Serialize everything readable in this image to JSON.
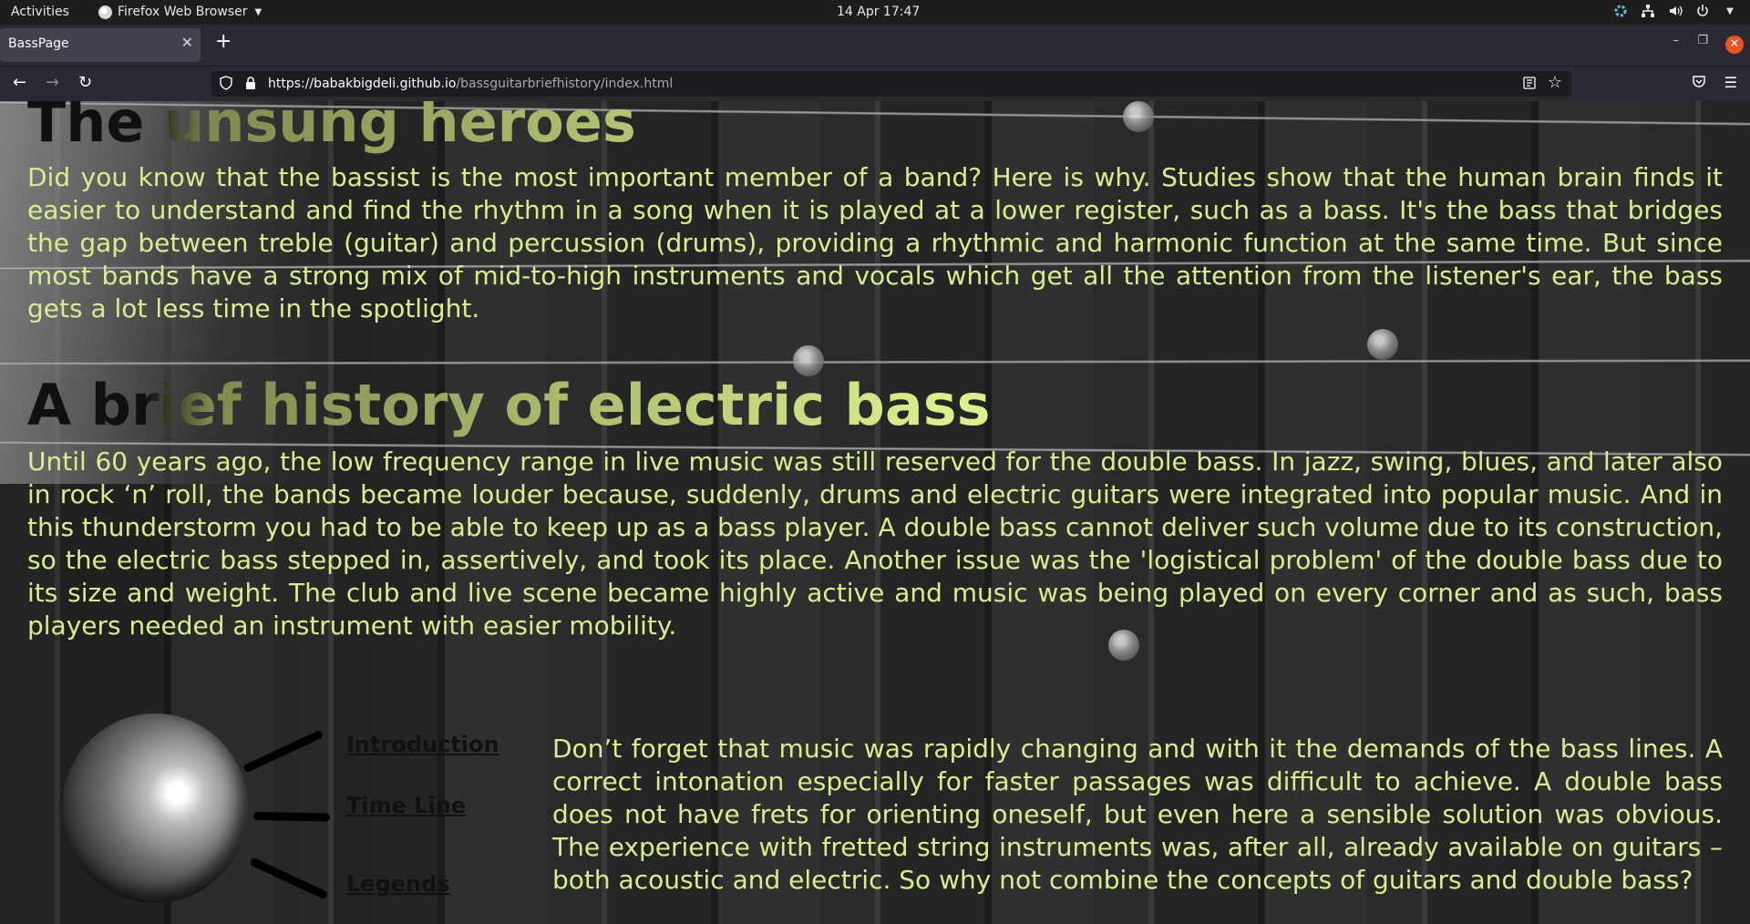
{
  "system_bar": {
    "activities": "Activities",
    "app_name": "Firefox Web Browser",
    "datetime": "14 Apr  17:47"
  },
  "browser": {
    "tab_title": "BassPage",
    "url_host": "https://babakbigdeli.github.io",
    "url_path": "/bassguitarbriefhistory/index.html"
  },
  "page": {
    "heading1": "The unsung heroes",
    "para1": "Did you know that the bassist is the most important member of a band? Here is why. Studies show that the human brain finds it easier to understand and find the rhythm in a song when it is played at a lower register, such as a bass. It's the bass that bridges the gap between treble (guitar) and percussion (drums), providing a rhythmic and harmonic function at the same time. But since most bands have a strong mix of mid-to-high instruments and vocals which get all the attention from the listener's ear, the bass gets a lot less time in the spotlight.",
    "heading2": "A brief history of electric bass",
    "para2": "Until 60 years ago, the low frequency range in live music was still reserved for the double bass. In jazz, swing, blues, and later also in rock ‘n’ roll, the bands became louder because, suddenly, drums and electric guitars were integrated into popular music. And in this thunderstorm you had to be able to keep up as a bass player. A double bass cannot deliver such volume due to its construction, so the electric bass stepped in, assertively, and took its place. Another issue was the 'logistical problem' of the double bass due to its size and weight. The club and live scene became highly active and music was being played on every corner and as such, bass players needed an instrument with easier mobility.",
    "para3": "Don’t forget that music was rapidly changing and with it the demands of the bass lines. A correct intonation especially for faster passages was difficult to achieve. A double bass does not have frets for orienting oneself, but even here a sensible solution was obvious. The experience with fretted string instruments was, after all, already available on guitars – both acoustic and electric. So why not combine the concepts of guitars and double bass?",
    "nav_links": [
      "Introduction",
      "Time Line",
      "Legends"
    ]
  }
}
